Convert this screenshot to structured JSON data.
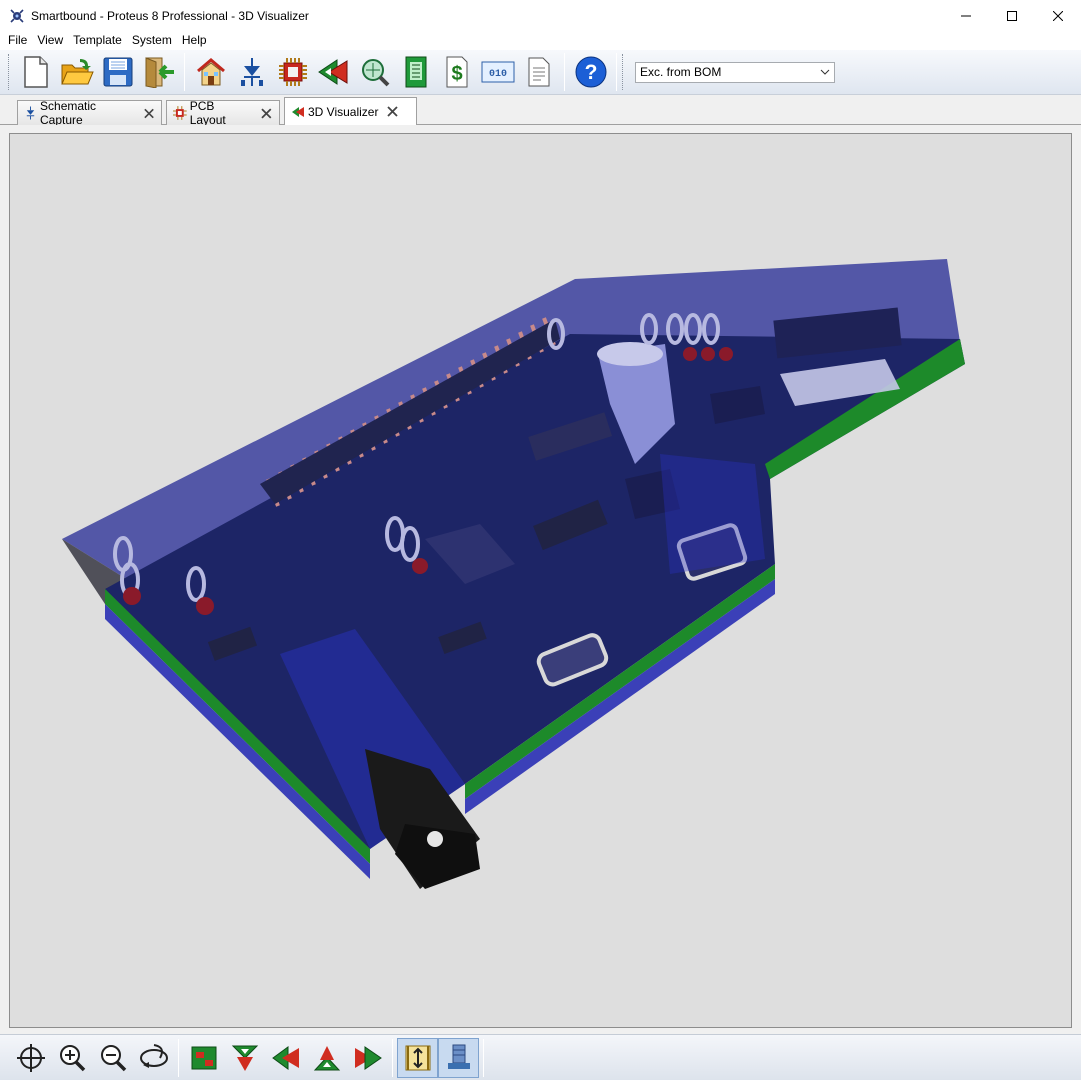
{
  "window": {
    "title": "Smartbound - Proteus 8 Professional - 3D Visualizer",
    "app_icon": "proteus-app-icon",
    "controls": [
      "minimize-icon",
      "maximize-icon",
      "close-icon"
    ]
  },
  "menu": {
    "items": [
      "File",
      "View",
      "Template",
      "System",
      "Help"
    ]
  },
  "toolbar": {
    "buttons": [
      "new-file-icon",
      "open-folder-icon",
      "save-disk-icon",
      "close-project-icon",
      "home-icon",
      "schematic-capture-icon",
      "pcb-layout-icon",
      "3d-visualizer-icon",
      "gerber-viewer-icon",
      "design-explorer-icon",
      "bill-of-materials-icon",
      "source-code-icon",
      "design-notes-icon",
      "help-icon"
    ],
    "bom_filter": {
      "value": "Exc. from BOM"
    }
  },
  "tabs": [
    {
      "label": "Schematic Capture",
      "icon": "schematic-tab-icon",
      "active": false
    },
    {
      "label": "PCB Layout",
      "icon": "pcb-tab-icon",
      "active": false
    },
    {
      "label": "3D Visualizer",
      "icon": "3d-tab-icon",
      "active": true
    }
  ],
  "viewport": {
    "background": "#dedede",
    "board_color": "#2b3a8a",
    "enclosure_color": "#3a3fa8",
    "pcb_edge_color": "#1d8a2a"
  },
  "bottom_toolbar": {
    "buttons": [
      "crosshair-icon",
      "zoom-in-icon",
      "zoom-out-icon",
      "orbit-icon",
      "top-view-icon",
      "front-view-icon",
      "left-view-icon",
      "back-view-icon",
      "right-view-icon",
      "height-mode-icon",
      "component-height-icon"
    ]
  }
}
